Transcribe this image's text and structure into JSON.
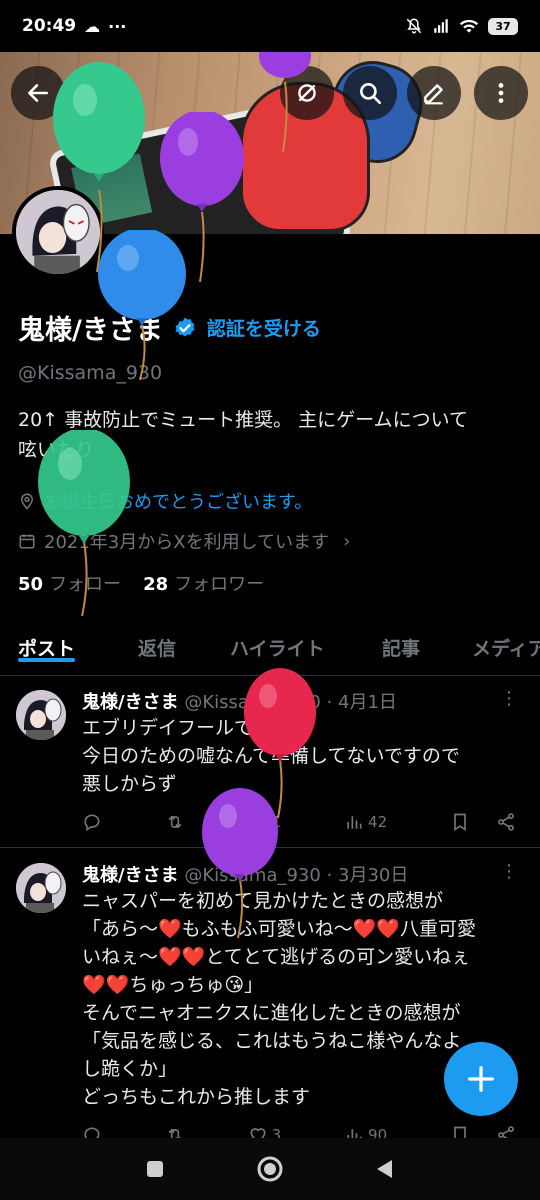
{
  "status_bar": {
    "time": "20:49",
    "battery": "37",
    "icons": [
      "cloud-icon",
      "more-dots-icon",
      "mute-icon",
      "signal-icon",
      "wifi-icon",
      "battery-icon"
    ]
  },
  "profile": {
    "display_name": "鬼様/きさま",
    "verify_label": "認証を受ける",
    "handle": "@Kissama_930",
    "bio_line1": "20↑ 事故防止でミュート推奨。 主にゲームについて",
    "bio_line2": "呟いたり",
    "birthday": "お誕生日おめでとうございます。",
    "joined": "2021年3月からXを利用しています",
    "following_count": "50",
    "following_label": "フォロー",
    "followers_count": "28",
    "followers_label": "フォロワー"
  },
  "tabs": [
    {
      "label": "ポスト",
      "active": true
    },
    {
      "label": "返信"
    },
    {
      "label": "ハイライト"
    },
    {
      "label": "記事"
    },
    {
      "label": "メディア"
    }
  ],
  "posts": [
    {
      "name": "鬼様/きさま",
      "handle": "@Kissama_930",
      "date": "· 4月1日",
      "lines": [
        "エブリデイフールです",
        "今日のための嘘なんて準備してないですので",
        "悪しからず"
      ],
      "likes": "1",
      "views": "42"
    },
    {
      "name": "鬼様/きさま",
      "handle": "@Kissama_930",
      "date": "· 3月30日",
      "lines": [
        "ニャスパーを初めて見かけたときの感想が",
        "「あら〜❤️もふもふ可愛いね〜❤️❤️八重可愛",
        "いねぇ〜❤️❤️とてとて逃げるの可ン愛いねぇ",
        "❤️❤️ちゅっちゅ😘」",
        "そんでニャオニクスに進化したときの感想が",
        "「気品を感じる、これはもうねこ様やんなよ",
        "し跪くか」",
        "どっちもこれから推します"
      ],
      "likes": "3",
      "views": "90"
    }
  ],
  "colors": {
    "accent": "#1d9bf0",
    "muted": "#71767b",
    "background": "#000000"
  }
}
